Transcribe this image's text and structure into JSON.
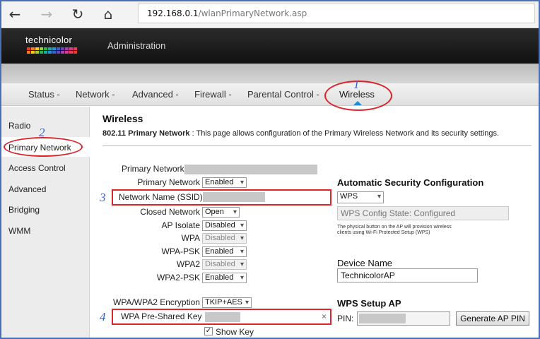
{
  "browser": {
    "back": "←",
    "forward": "→",
    "refresh": "↻",
    "home": "⌂",
    "url_host": "192.168.0.1",
    "url_path": "/wlanPrimaryNetwork.asp"
  },
  "header": {
    "logo_text": "technicolor",
    "admin_title": "Administration"
  },
  "tabs": [
    {
      "label": "Status -"
    },
    {
      "label": "Network -"
    },
    {
      "label": "Advanced -"
    },
    {
      "label": "Firewall -"
    },
    {
      "label": "Parental Control -"
    },
    {
      "label": "Wireless",
      "active": true
    }
  ],
  "sidebar": {
    "items": [
      {
        "label": "Radio"
      },
      {
        "label": "Primary Network",
        "selected": true
      },
      {
        "label": "Access Control"
      },
      {
        "label": "Advanced"
      },
      {
        "label": "Bridging"
      },
      {
        "label": "WMM"
      }
    ]
  },
  "content": {
    "title": "Wireless",
    "desc_bold": "802.11 Primary Network",
    "desc_rest": " :  This page allows configuration of the Primary Wireless Network and its security settings.",
    "fields": {
      "primary_network_label": "Primary Network",
      "primary_network_select_label": "Primary Network",
      "primary_network_value": "Enabled",
      "ssid_label": "Network Name (SSID)",
      "closed_network_label": "Closed Network",
      "closed_network_value": "Open",
      "ap_isolate_label": "AP Isolate",
      "ap_isolate_value": "Disabled",
      "wpa_label": "WPA",
      "wpa_value": "Disabled",
      "wpa_psk_label": "WPA-PSK",
      "wpa_psk_value": "Enabled",
      "wpa2_label": "WPA2",
      "wpa2_value": "Disabled",
      "wpa2_psk_label": "WPA2-PSK",
      "wpa2_psk_value": "Enabled",
      "encryption_label": "WPA/WPA2 Encryption",
      "encryption_value": "TKIP+AES",
      "psk_label": "WPA Pre-Shared Key",
      "psk_clear": "×",
      "show_key_label": "Show Key",
      "show_key_check": "✓"
    },
    "auto_sec": {
      "title": "Automatic Security Configuration",
      "select_value": "WPS",
      "state_value": "WPS Config State: Configured",
      "note": "The physical button on the AP will provision wireless clients using Wi-Fi Protected Setup (WPS)"
    },
    "device": {
      "title": "Device Name",
      "value": "TechnicolorAP"
    },
    "wps_ap": {
      "title": "WPS Setup AP",
      "pin_label": "PIN:",
      "generate_button": "Generate AP PIN"
    }
  },
  "annotations": {
    "n1": "1",
    "n2": "2",
    "n3": "3",
    "n4": "4"
  },
  "colors": {
    "annotation_red": "#d9252b",
    "annotation_blue": "#3a5fc2",
    "frame_blue": "#4a6fb5",
    "active_tab_marker": "#1a8fd6"
  }
}
